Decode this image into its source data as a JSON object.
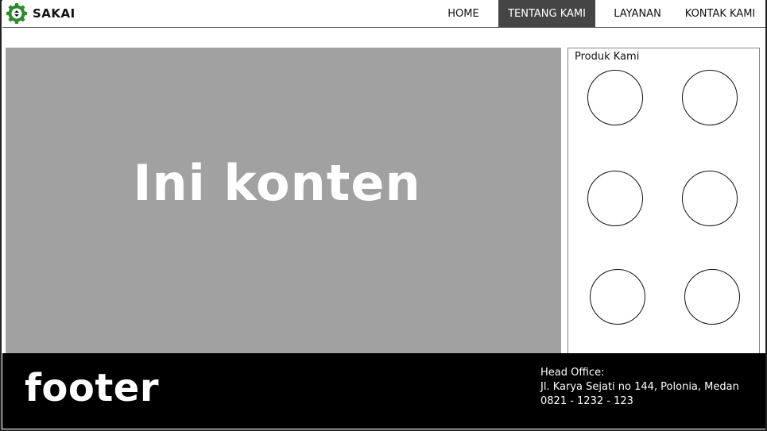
{
  "brand": {
    "name": "SAKAI",
    "logo_icon": "gear-arrows-icon",
    "accent_color": "#2e8b2e"
  },
  "nav": {
    "items": [
      {
        "label": "HOME",
        "active": false
      },
      {
        "label": "TENTANG KAMI",
        "active": true
      },
      {
        "label": "LAYANAN",
        "active": false
      },
      {
        "label": "KONTAK KAMI",
        "active": false
      }
    ]
  },
  "content": {
    "heading": "Ini konten"
  },
  "products": {
    "title": "Produk Kami"
  },
  "footer": {
    "title": "footer",
    "office_label": "Head Office:",
    "address": "Jl. Karya Sejati no 144, Polonia, Medan",
    "phone": "0821 - 1232 - 123"
  }
}
